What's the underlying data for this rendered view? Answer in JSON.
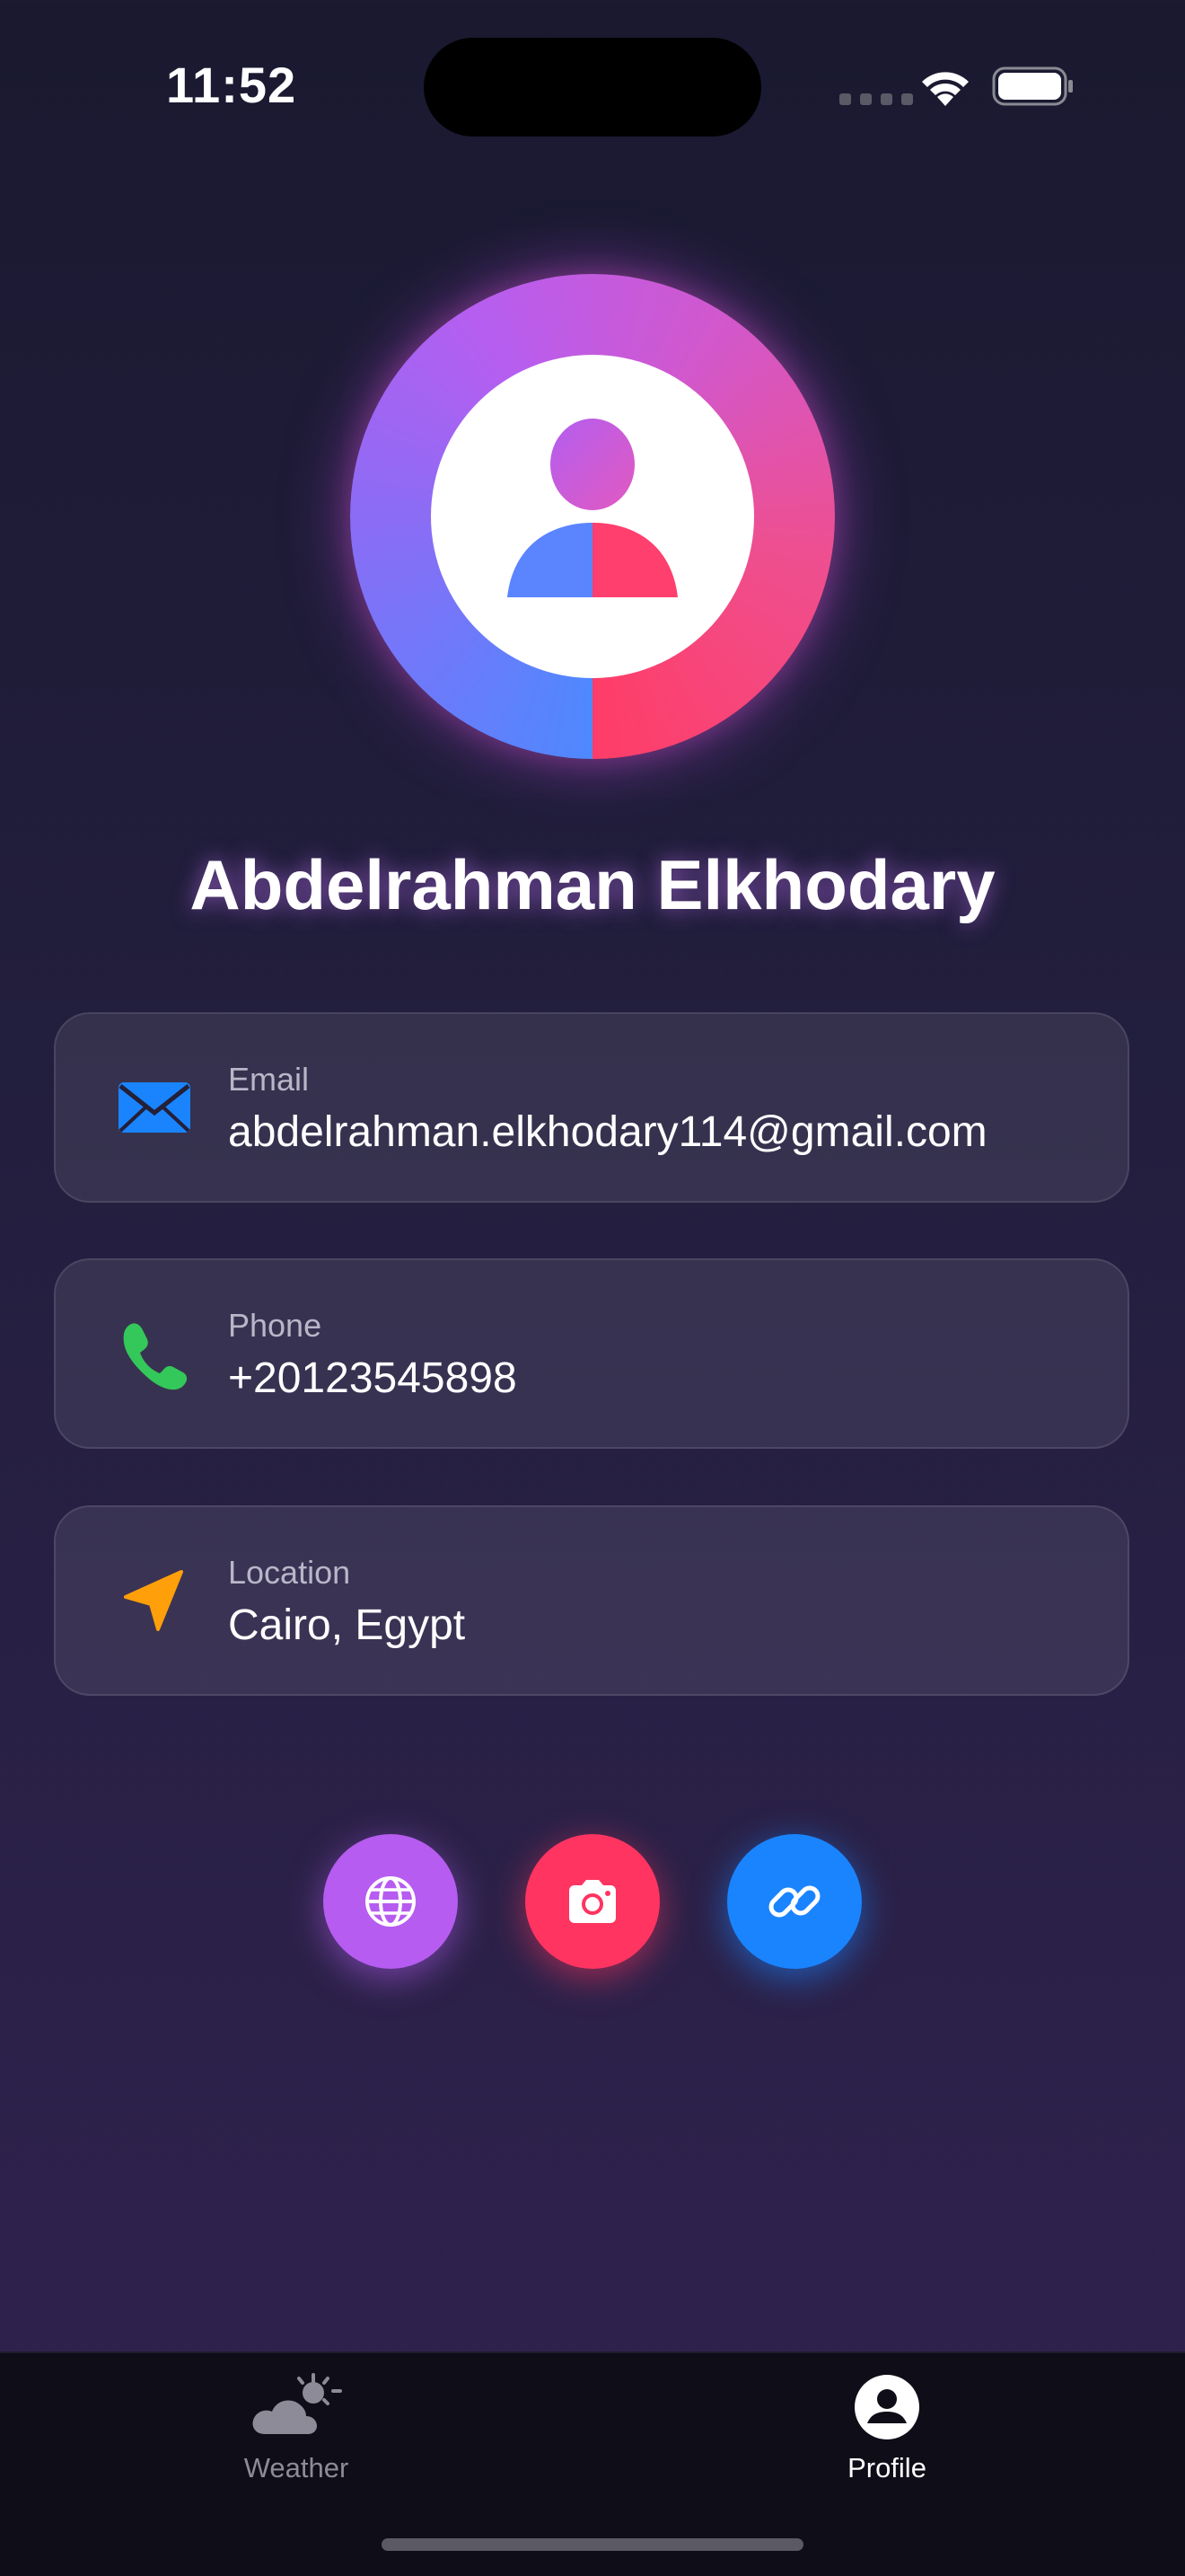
{
  "status_bar": {
    "time": "11:52"
  },
  "profile": {
    "name": "Abdelrahman Elkhodary"
  },
  "cards": {
    "email": {
      "label": "Email",
      "value": "abdelrahman.elkhodary114@gmail.com",
      "icon": "envelope-icon"
    },
    "phone": {
      "label": "Phone",
      "value": "+20123545898",
      "icon": "phone-icon"
    },
    "location": {
      "label": "Location",
      "value": "Cairo, Egypt",
      "icon": "location-arrow-icon"
    }
  },
  "actions": [
    {
      "icon": "globe-icon",
      "color": "#b65cf0"
    },
    {
      "icon": "camera-icon",
      "color": "#ff3461"
    },
    {
      "icon": "link-icon",
      "color": "#1a84ff"
    }
  ],
  "tab_bar": {
    "weather_label": "Weather",
    "profile_label": "Profile",
    "active_tab": "Profile"
  },
  "colors": {
    "email_icon": "#1a84ff",
    "phone_icon": "#34c759",
    "location_icon": "#ff9f0a"
  }
}
